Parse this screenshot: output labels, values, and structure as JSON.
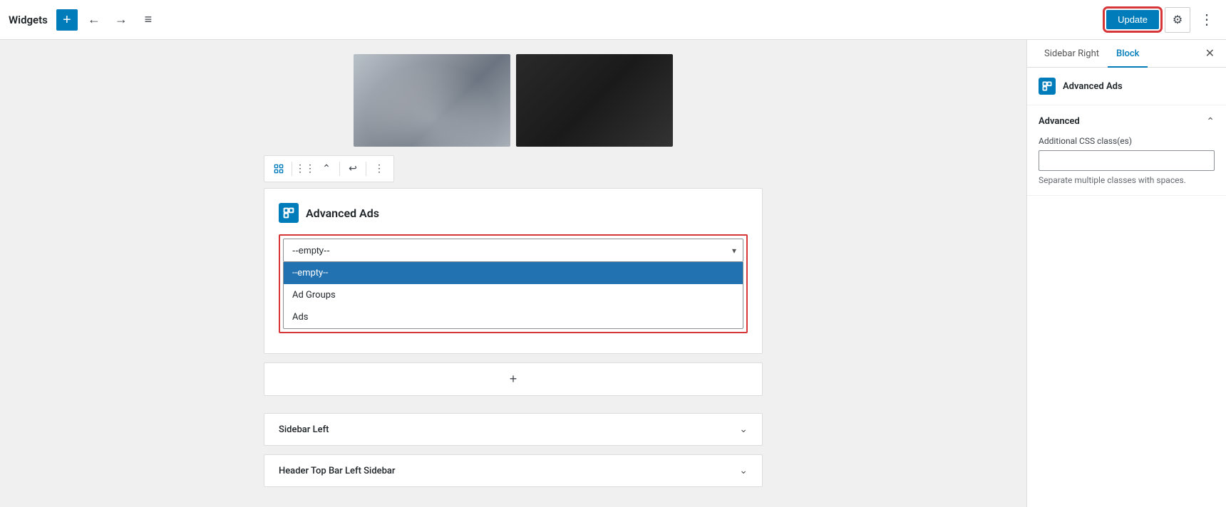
{
  "toolbar": {
    "title": "Widgets",
    "add_label": "+",
    "update_label": "Update"
  },
  "canvas": {
    "widget_title": "Advanced Ads",
    "block_toolbar": {
      "icon1": "▣",
      "icon2": "⠿",
      "icon3": "↕",
      "icon4": "↺",
      "icon5": "⋮"
    },
    "dropdown": {
      "selected_value": "--empty--",
      "options": [
        {
          "label": "--empty--",
          "selected": true
        },
        {
          "label": "Ad Groups",
          "selected": false
        },
        {
          "label": "Ads",
          "selected": false
        }
      ]
    },
    "add_block_icon": "+",
    "sidebar_sections": [
      {
        "label": "Sidebar Left"
      },
      {
        "label": "Header Top Bar Left Sidebar"
      }
    ]
  },
  "right_panel": {
    "tabs": [
      {
        "label": "Sidebar Right",
        "active": false
      },
      {
        "label": "Block",
        "active": true
      }
    ],
    "block_name": "Advanced Ads",
    "advanced_section": {
      "title": "Advanced",
      "field_label": "Additional CSS class(es)",
      "field_placeholder": "",
      "help_text": "Separate multiple classes with spaces."
    }
  }
}
